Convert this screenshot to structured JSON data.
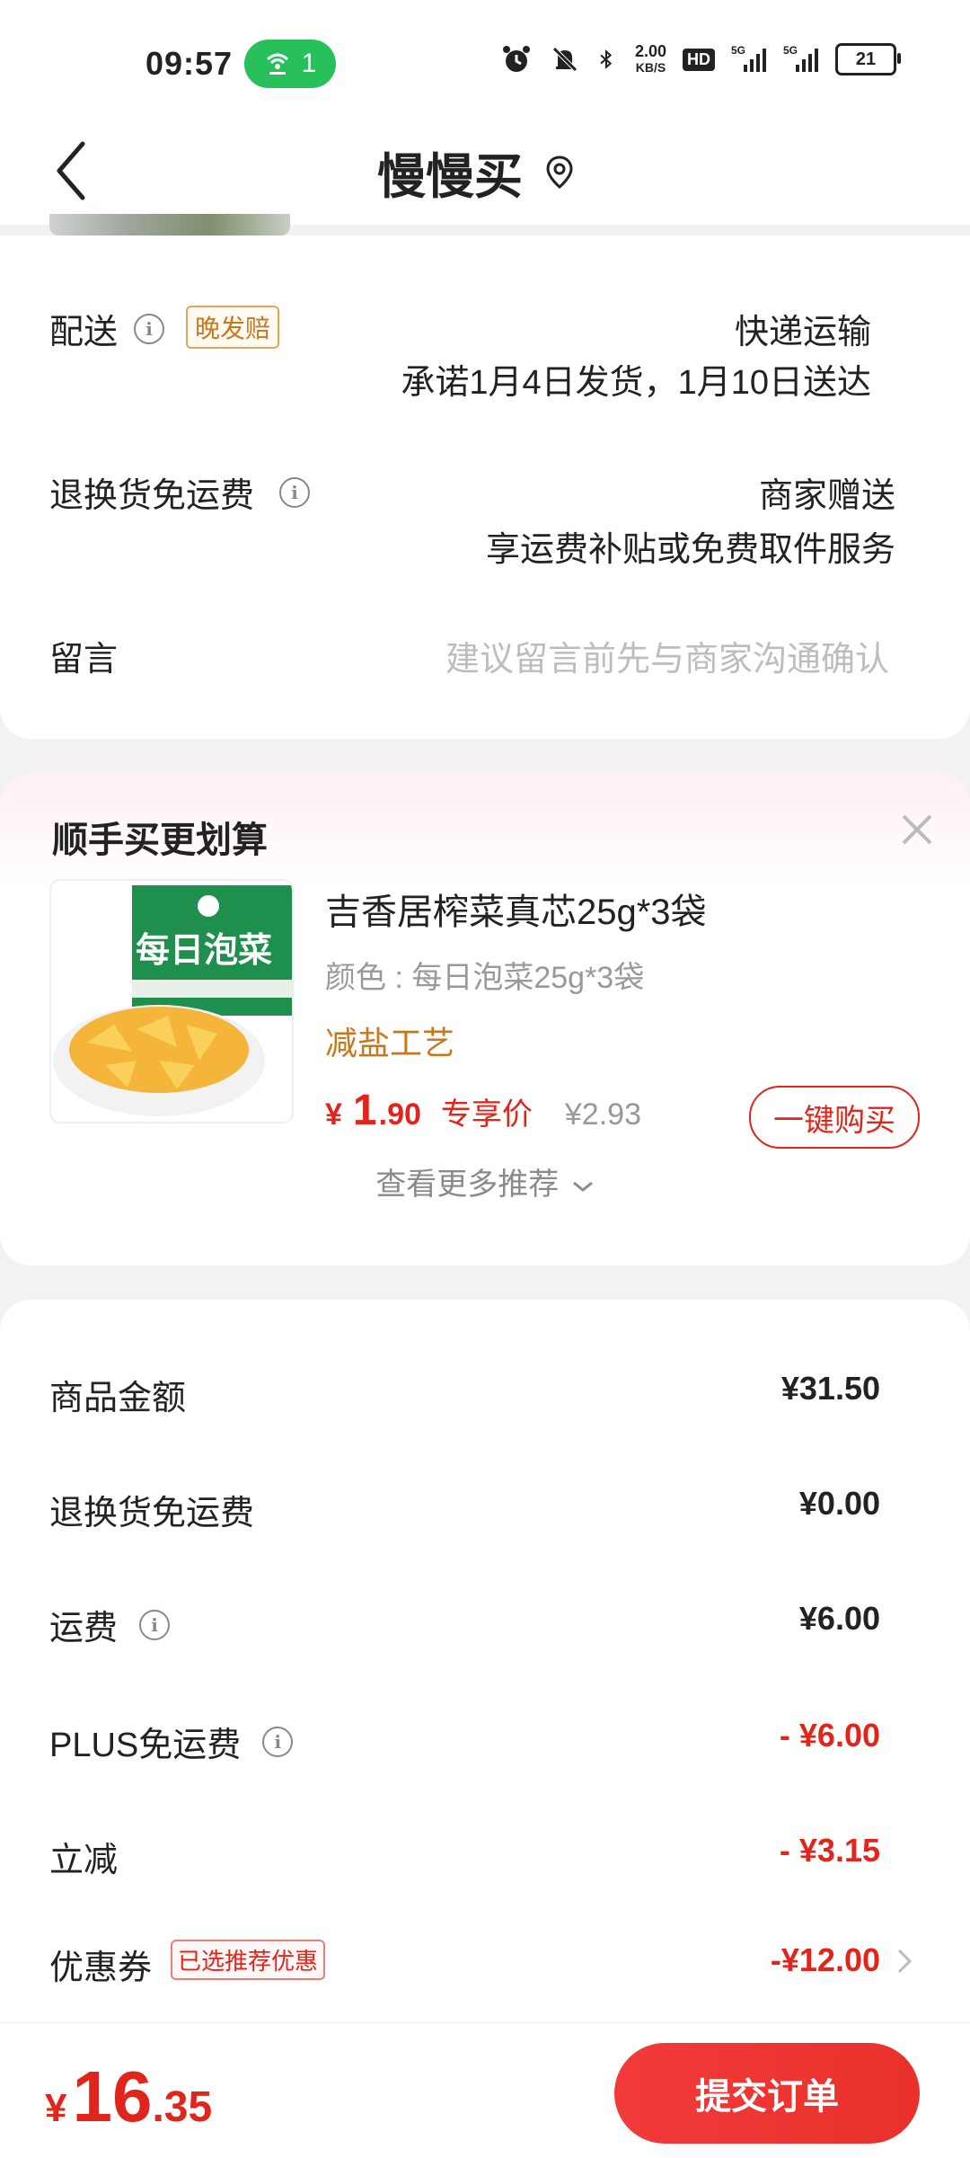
{
  "status_bar": {
    "time": "09:57",
    "hotspot_count": "1",
    "net_speed_top": "2.00",
    "net_speed_unit": "KB/S",
    "hd_label": "HD",
    "signal_label": "5G",
    "battery": "21"
  },
  "header": {
    "title": "慢慢买"
  },
  "delivery": {
    "label": "配送",
    "tag": "晚发赔",
    "method": "快递运输",
    "promise": "承诺1月4日发货，1月10日送达"
  },
  "return_shipping": {
    "label": "退换货免运费",
    "value": "商家赠送",
    "desc": "享运费补贴或免费取件服务"
  },
  "message": {
    "label": "留言",
    "placeholder": "建议留言前先与商家沟通确认"
  },
  "recommend": {
    "heading": "顺手买更划算",
    "product": {
      "name": "吉香居榨菜真芯25g*3袋",
      "attr": "颜色 : 每日泡菜25g*3袋",
      "feature": "减盐工艺",
      "price_symbol": "¥",
      "price_int": "1",
      "price_dec": ".90",
      "price_tag": "专享价",
      "orig_price": "¥2.93",
      "buy_label": "一键购买",
      "image_text": "每日泡菜"
    },
    "more_label": "查看更多推荐"
  },
  "summary": {
    "rows": [
      {
        "label": "商品金额",
        "value": "¥31.50"
      },
      {
        "label": "退换货免运费",
        "value": "¥0.00"
      },
      {
        "label": "运费",
        "value": "¥6.00"
      },
      {
        "label": "PLUS免运费",
        "value": "- ¥6.00"
      },
      {
        "label": "立减",
        "value": "- ¥3.15"
      },
      {
        "label": "优惠券",
        "value": "-¥12.00",
        "tag": "已选推荐优惠"
      }
    ]
  },
  "footer": {
    "symbol": "¥",
    "total_int": "16",
    "total_dec": ".35",
    "submit_label": "提交订单"
  },
  "colors": {
    "accent_red": "#e1251b",
    "tag_orange": "#c9771c",
    "hotspot_green": "#27c05a"
  }
}
